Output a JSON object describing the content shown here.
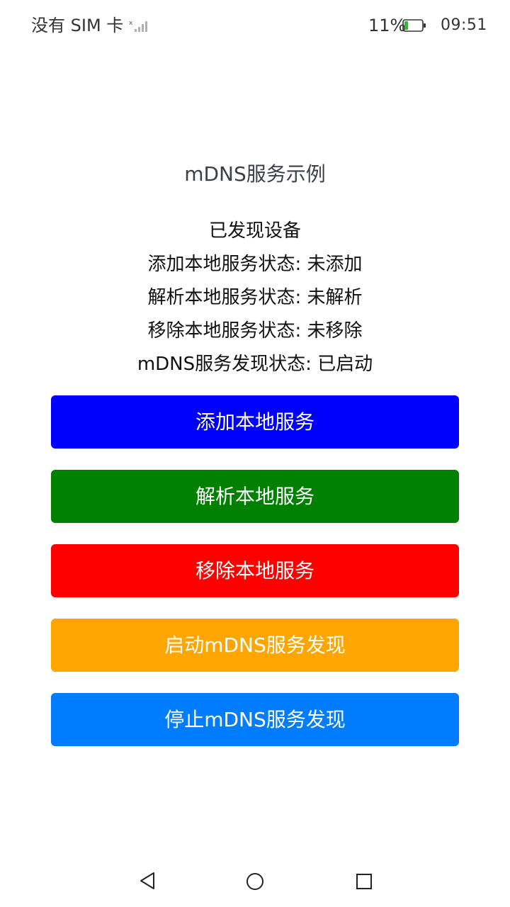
{
  "status_bar": {
    "carrier": "没有 SIM 卡",
    "battery_percent": "11%",
    "battery_level": 0.11,
    "time": "09:51",
    "icons": [
      "signal-icon",
      "battery-icon"
    ]
  },
  "page": {
    "title": "mDNS服务示例",
    "status_lines": [
      "已发现设备",
      "添加本地服务状态: 未添加",
      "解析本地服务状态: 未解析",
      "移除本地服务状态: 未移除",
      "mDNS服务发现状态: 已启动"
    ]
  },
  "buttons": [
    {
      "label": "添加本地服务",
      "color": "#0000ff"
    },
    {
      "label": "解析本地服务",
      "color": "#008000"
    },
    {
      "label": "移除本地服务",
      "color": "#ff0000"
    },
    {
      "label": "启动mDNS服务发现",
      "color": "#ffa500"
    },
    {
      "label": "停止mDNS服务发现",
      "color": "#007dff"
    }
  ],
  "nav_bar": {
    "icons": [
      "back-icon",
      "home-icon",
      "recent-apps-icon"
    ]
  }
}
